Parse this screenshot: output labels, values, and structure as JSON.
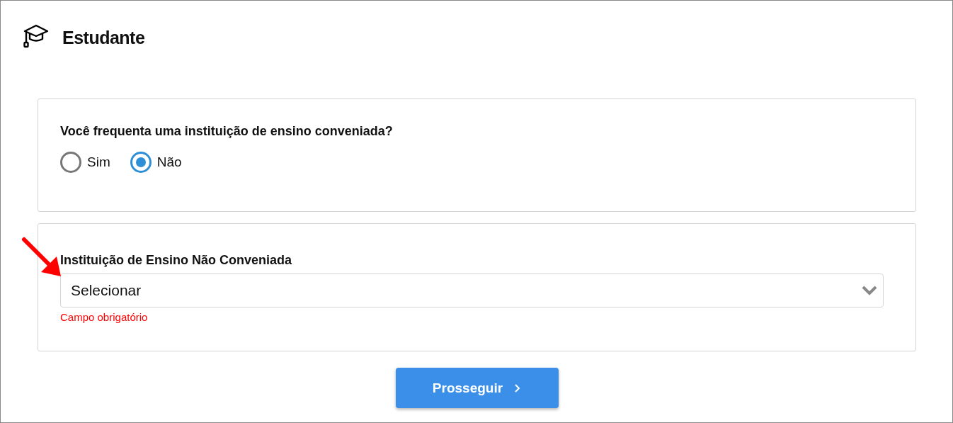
{
  "header": {
    "title": "Estudante"
  },
  "question": {
    "text": "Você frequenta uma instituição de ensino conveniada?",
    "options": [
      {
        "label": "Sim",
        "selected": false
      },
      {
        "label": "Não",
        "selected": true
      }
    ]
  },
  "institution_field": {
    "label": "Instituição de Ensino Não Conveniada",
    "value": "Selecionar",
    "error": "Campo obrigatório"
  },
  "button": {
    "label": "Prosseguir"
  }
}
